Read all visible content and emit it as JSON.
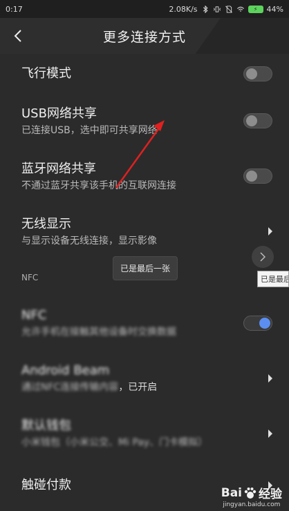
{
  "status": {
    "time": "0:17",
    "speed": "2.08K/s",
    "battery": "44%"
  },
  "header": {
    "title": "更多连接方式"
  },
  "items": [
    {
      "title": "飞行模式",
      "subtitle": "",
      "control": "toggle",
      "state": "off"
    },
    {
      "title": "USB网络共享",
      "subtitle": "已连接USB，选中即可共享网络",
      "control": "toggle",
      "state": "off"
    },
    {
      "title": "蓝牙网络共享",
      "subtitle": "不通过蓝牙共享该手机的互联网连接",
      "control": "toggle",
      "state": "off"
    },
    {
      "title": "无线显示",
      "subtitle": "与显示设备无线连接，显示影像",
      "control": "chevron"
    }
  ],
  "section": {
    "nfc_header": "NFC"
  },
  "nfc_items": [
    {
      "title": "NFC",
      "subtitle": "允许手机在接触其他设备时交换数据",
      "control": "toggle",
      "state": "on",
      "blurred": true
    },
    {
      "title": "Android Beam",
      "subtitle": "通过NFC连接传输内容",
      "subtitle_tail": "，已开启",
      "control": "chevron",
      "blurred": true
    },
    {
      "title": "默认钱包",
      "subtitle": "小米钱包（小米公交、Mi Pay、门卡模拟）",
      "control": "chevron",
      "blurred": true
    },
    {
      "title": "触碰付款",
      "subtitle": "",
      "control": "chevron"
    }
  ],
  "overlay": {
    "toast": "已是最后一张",
    "tip_right": "已是最后一张"
  },
  "watermark": {
    "brand_a": "Bai",
    "brand_b": "经验",
    "url": "jingyan.baidu.com"
  },
  "colors": {
    "background": "#2b2b2b",
    "toggle_on": "#5b8ef0",
    "annotation_arrow": "#e02020"
  }
}
